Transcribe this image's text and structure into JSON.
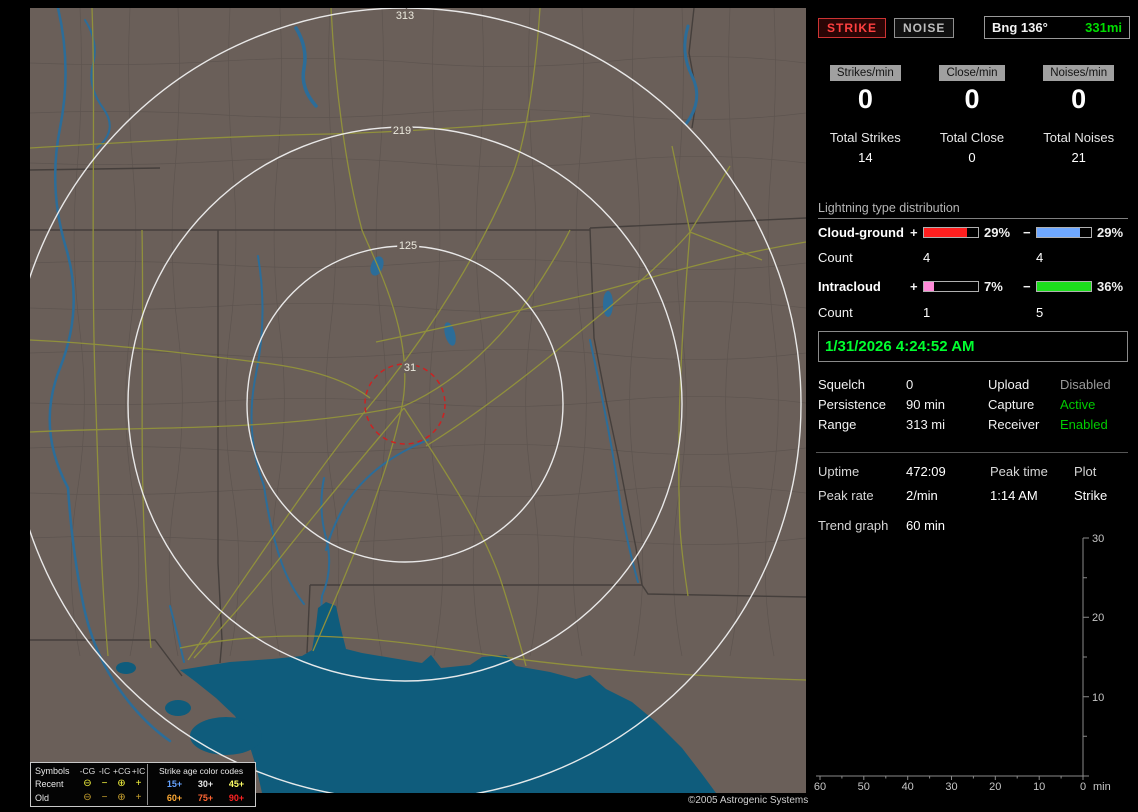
{
  "colors": {
    "land": "#6a5f59",
    "gulf_water": "#0f5c7c",
    "river_blue": "#2c6d99",
    "road_yellow": "#90903c",
    "range_ring": "#f0f0f0",
    "alarm_ring_red": "#cc2222",
    "pos_cg_red": "#ff1f1f",
    "neg_cg_blue": "#6fa8ff",
    "pos_ic_pink": "#ff8ad8",
    "neg_ic_green": "#1ddd1d",
    "datetime_green": "#00ff2f",
    "status_green": "#00cc00",
    "status_disabled_gray": "#9a9a9a"
  },
  "map": {
    "ring_labels": [
      "313",
      "219",
      "125",
      "31"
    ],
    "copyright": "©2005 Astrogenic Systems",
    "legend": {
      "symbols_header": "Symbols",
      "columns": [
        "-CG",
        "-IC",
        "+CG",
        "+IC"
      ],
      "age_header": "Strike age color codes",
      "recent_label": "Recent",
      "old_label": "Old",
      "recent_symbols": [
        "⊖",
        "−",
        "⊕",
        "+"
      ],
      "old_symbols": [
        "⊖",
        "−",
        "⊕",
        "+"
      ],
      "recent_ages": [
        {
          "text": "15+",
          "color": "#66a3ff"
        },
        {
          "text": "30+",
          "color": "#e8e8e8"
        },
        {
          "text": "45+",
          "color": "#ffff66"
        }
      ],
      "old_ages": [
        {
          "text": "60+",
          "color": "#ffaa33"
        },
        {
          "text": "75+",
          "color": "#ff6633"
        },
        {
          "text": "90+",
          "color": "#ff2222"
        }
      ]
    }
  },
  "panel": {
    "strike_button": "STRIKE",
    "noise_button": "NOISE",
    "bearing": {
      "label": "Bng 136°",
      "range": "331mi"
    },
    "counters": [
      {
        "label": "Strikes/min",
        "value": "0"
      },
      {
        "label": "Close/min",
        "value": "0"
      },
      {
        "label": "Noises/min",
        "value": "0"
      }
    ],
    "totals": [
      {
        "label": "Total Strikes",
        "value": "14"
      },
      {
        "label": "Total Close",
        "value": "0"
      },
      {
        "label": "Total Noises",
        "value": "21"
      }
    ],
    "distribution": {
      "title": "Lightning type distribution",
      "cloud_ground": {
        "label": "Cloud-ground",
        "plus": "+",
        "minus": "−",
        "pos_pct": "29%",
        "pos_fill": 80,
        "neg_pct": "29%",
        "neg_fill": 80,
        "count_label": "Count",
        "pos_count": "4",
        "neg_count": "4"
      },
      "intracloud": {
        "label": "Intracloud",
        "plus": "+",
        "minus": "−",
        "pos_pct": "7%",
        "pos_fill": 19,
        "neg_pct": "36%",
        "neg_fill": 100,
        "count_label": "Count",
        "pos_count": "1",
        "neg_count": "5"
      }
    },
    "datetime": "1/31/2026 4:24:52 AM",
    "settings": {
      "rows": [
        {
          "label": "Squelch",
          "value": "0",
          "label2": "Upload",
          "value2": "Disabled"
        },
        {
          "label": "Persistence",
          "value": "90 min",
          "label2": "Capture",
          "value2": "Active"
        },
        {
          "label": "Range",
          "value": "313 mi",
          "label2": "Receiver",
          "value2": "Enabled"
        }
      ]
    },
    "stats": {
      "uptime_label": "Uptime",
      "uptime_value": "472:09",
      "peak_time_label": "Peak time",
      "peak_time_value": "1:14 AM",
      "plot_label": "Plot",
      "plot_value": "Strike",
      "peak_rate_label": "Peak rate",
      "peak_rate_value": "2/min",
      "trend_label": "Trend graph",
      "trend_value": "60 min"
    },
    "trend_graph": {
      "y_ticks": [
        "30",
        "20",
        "10"
      ],
      "x_ticks": [
        "60",
        "50",
        "40",
        "30",
        "20",
        "10",
        "0"
      ],
      "x_unit": "min"
    }
  }
}
